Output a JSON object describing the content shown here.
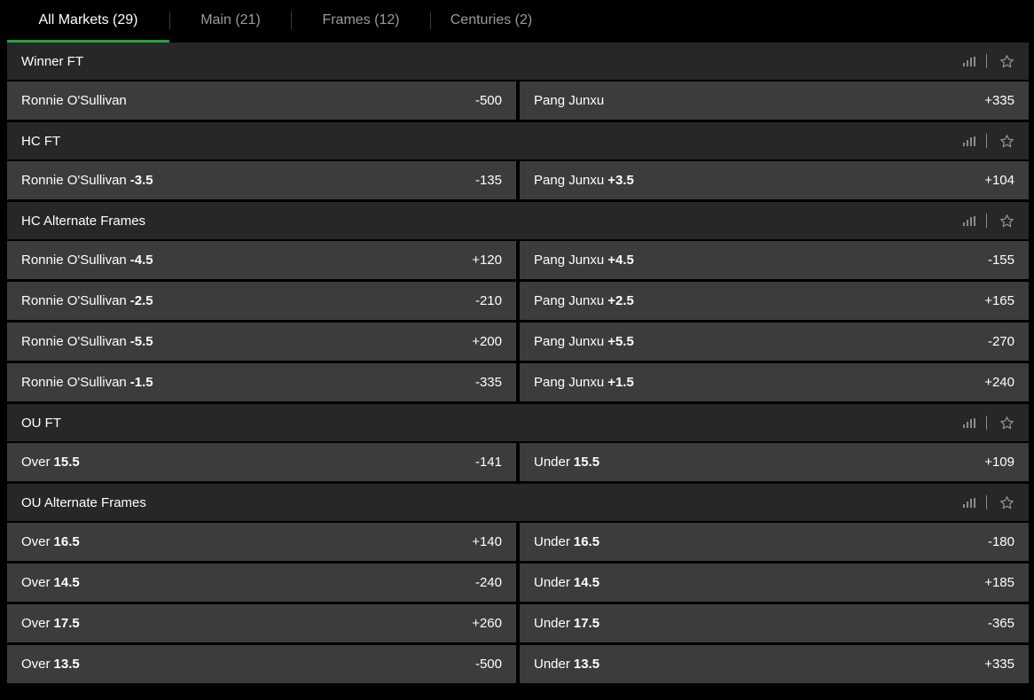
{
  "tabs": [
    {
      "label": "All Markets (29)",
      "active": true
    },
    {
      "label": "Main (21)",
      "active": false
    },
    {
      "label": "Frames (12)",
      "active": false
    },
    {
      "label": "Centuries (2)",
      "active": false
    }
  ],
  "colors": {
    "accent": "#1fa83a",
    "header_bg": "#272727",
    "button_bg": "#3c3c3c"
  },
  "markets": [
    {
      "title": "Winner FT",
      "rows": [
        [
          {
            "name": "Ronnie O'Sullivan",
            "line": "",
            "price": "-500"
          },
          {
            "name": "Pang Junxu",
            "line": "",
            "price": "+335"
          }
        ]
      ]
    },
    {
      "title": "HC FT",
      "rows": [
        [
          {
            "name": "Ronnie O'Sullivan",
            "line": "-3.5",
            "price": "-135"
          },
          {
            "name": "Pang Junxu",
            "line": "+3.5",
            "price": "+104"
          }
        ]
      ]
    },
    {
      "title": "HC Alternate Frames",
      "rows": [
        [
          {
            "name": "Ronnie O'Sullivan",
            "line": "-4.5",
            "price": "+120"
          },
          {
            "name": "Pang Junxu",
            "line": "+4.5",
            "price": "-155"
          }
        ],
        [
          {
            "name": "Ronnie O'Sullivan",
            "line": "-2.5",
            "price": "-210"
          },
          {
            "name": "Pang Junxu",
            "line": "+2.5",
            "price": "+165"
          }
        ],
        [
          {
            "name": "Ronnie O'Sullivan",
            "line": "-5.5",
            "price": "+200"
          },
          {
            "name": "Pang Junxu",
            "line": "+5.5",
            "price": "-270"
          }
        ],
        [
          {
            "name": "Ronnie O'Sullivan",
            "line": "-1.5",
            "price": "-335"
          },
          {
            "name": "Pang Junxu",
            "line": "+1.5",
            "price": "+240"
          }
        ]
      ]
    },
    {
      "title": "OU FT",
      "rows": [
        [
          {
            "name": "Over",
            "line": "15.5",
            "price": "-141"
          },
          {
            "name": "Under",
            "line": "15.5",
            "price": "+109"
          }
        ]
      ]
    },
    {
      "title": "OU Alternate Frames",
      "rows": [
        [
          {
            "name": "Over",
            "line": "16.5",
            "price": "+140"
          },
          {
            "name": "Under",
            "line": "16.5",
            "price": "-180"
          }
        ],
        [
          {
            "name": "Over",
            "line": "14.5",
            "price": "-240"
          },
          {
            "name": "Under",
            "line": "14.5",
            "price": "+185"
          }
        ],
        [
          {
            "name": "Over",
            "line": "17.5",
            "price": "+260"
          },
          {
            "name": "Under",
            "line": "17.5",
            "price": "-365"
          }
        ],
        [
          {
            "name": "Over",
            "line": "13.5",
            "price": "-500"
          },
          {
            "name": "Under",
            "line": "13.5",
            "price": "+335"
          }
        ]
      ]
    }
  ]
}
